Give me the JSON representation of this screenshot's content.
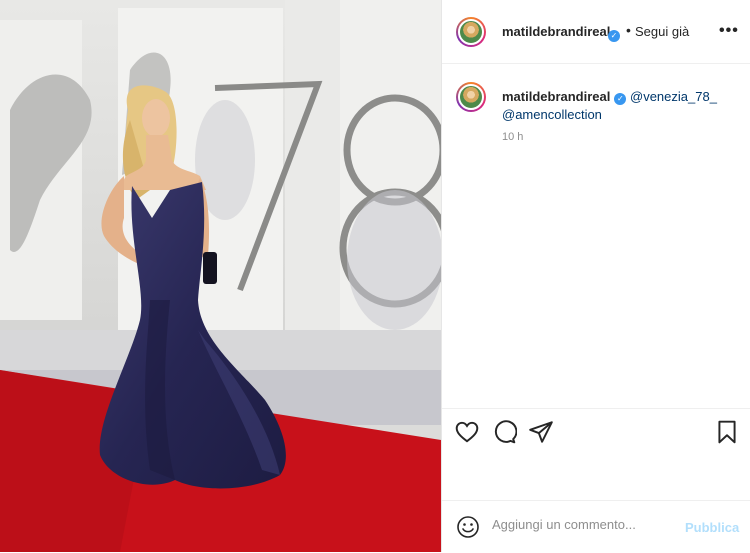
{
  "post": {
    "username": "matildebrandireal",
    "verified_icon": "verified-badge-icon",
    "separator": "•",
    "follow_state": "Segui già",
    "more_icon": "more-options-icon",
    "more_glyph": "•••"
  },
  "photo": {
    "backdrop_number": "78",
    "colors": {
      "carpet": "#c8111a",
      "gown": "#2b2a57",
      "wall": "#e4e4e2"
    }
  },
  "caption": {
    "username": "matildebrandireal",
    "mention_1": "@venezia_78_",
    "mention_2": "@amencollection",
    "timestamp": "10 h"
  },
  "actions": {
    "like_icon": "heart-icon",
    "comment_icon": "comment-icon",
    "share_icon": "paper-plane-icon",
    "save_icon": "bookmark-icon"
  },
  "comment_box": {
    "emoji_icon": "smiley-icon",
    "placeholder": "Aggiungi un commento...",
    "post_label": "Pubblica"
  }
}
